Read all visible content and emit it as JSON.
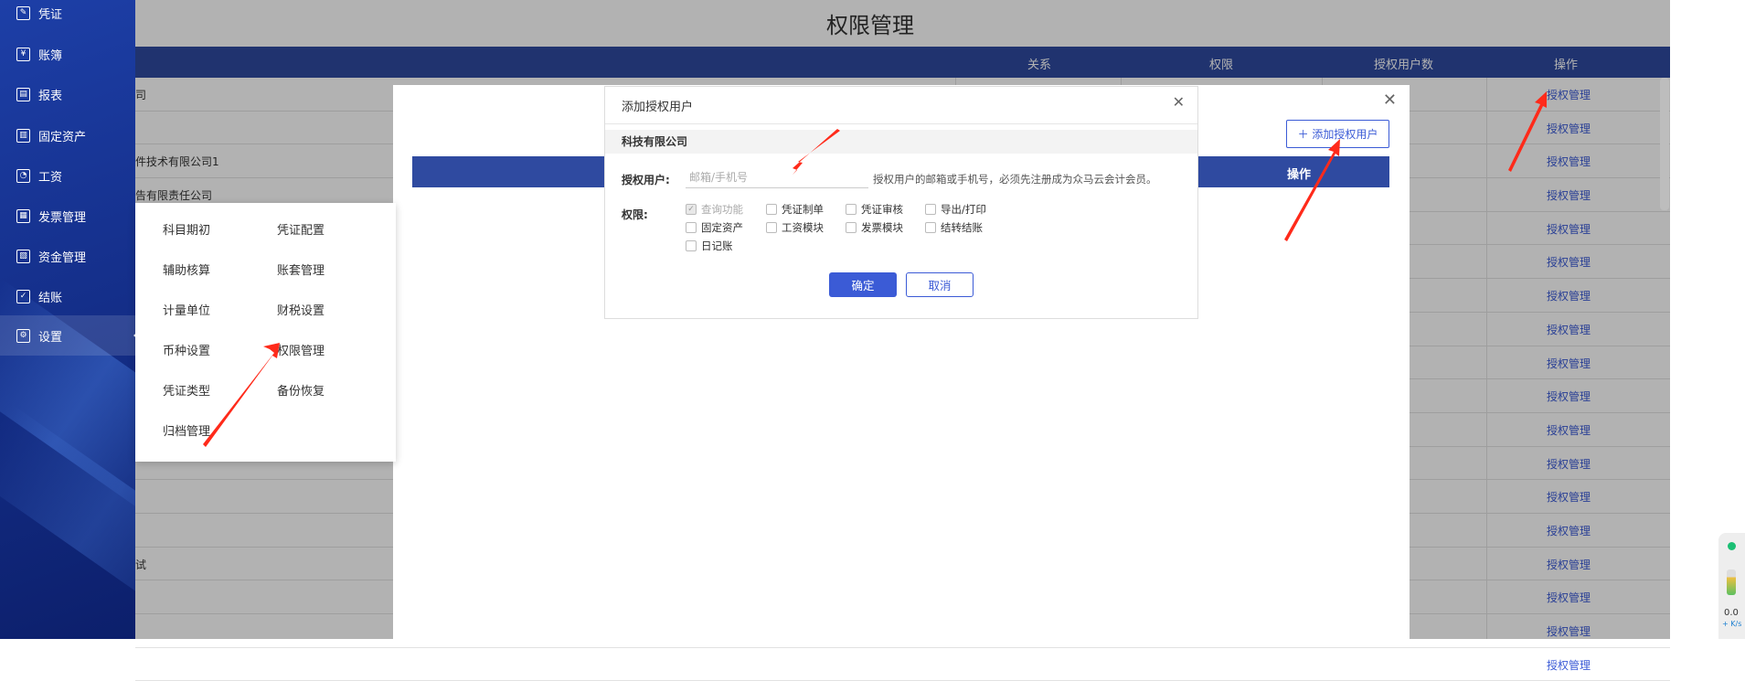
{
  "sidebar": {
    "items": [
      {
        "label": "凭证",
        "icon": "voucher-icon",
        "glyph": "✎"
      },
      {
        "label": "账簿",
        "icon": "yen-icon",
        "glyph": "¥"
      },
      {
        "label": "报表",
        "icon": "report-icon",
        "glyph": "▤"
      },
      {
        "label": "固定资产",
        "icon": "asset-icon",
        "glyph": "▥"
      },
      {
        "label": "工资",
        "icon": "salary-icon",
        "glyph": "◔"
      },
      {
        "label": "发票管理",
        "icon": "invoice-icon",
        "glyph": "▦"
      },
      {
        "label": "资金管理",
        "icon": "funds-icon",
        "glyph": "▧"
      },
      {
        "label": "结账",
        "icon": "checkout-icon",
        "glyph": "✓"
      },
      {
        "label": "设置",
        "icon": "gear-icon",
        "glyph": "⚙"
      }
    ],
    "active_index": 8
  },
  "page": {
    "title": "权限管理",
    "columns": {
      "relation": "关系",
      "permission": "权限",
      "user_count": "授权用户数",
      "actions": "操作"
    }
  },
  "rows": [
    {
      "company": "司",
      "op": "授权管理"
    },
    {
      "company": "",
      "op": "授权管理"
    },
    {
      "company": "件技术有限公司1",
      "op": "授权管理"
    },
    {
      "company": "告有限责任公司",
      "op": "授权管理"
    },
    {
      "company": "",
      "op": "授权管理"
    },
    {
      "company": "",
      "op": "授权管理"
    },
    {
      "company": "",
      "op": "授权管理"
    },
    {
      "company": "",
      "op": "授权管理"
    },
    {
      "company": "",
      "op": "授权管理"
    },
    {
      "company": "",
      "op": "授权管理"
    },
    {
      "company": "",
      "op": "授权管理"
    },
    {
      "company": "",
      "op": "授权管理"
    },
    {
      "company": "",
      "op": "授权管理"
    },
    {
      "company": "",
      "op": "授权管理"
    },
    {
      "company": "试",
      "op": "授权管理"
    },
    {
      "company": "",
      "op": "授权管理"
    },
    {
      "company": "",
      "op": "授权管理"
    },
    {
      "company": "",
      "op": "授权管理"
    }
  ],
  "submenu": {
    "items": [
      "科目期初",
      "凭证配置",
      "辅助核算",
      "账套管理",
      "计量单位",
      "财税设置",
      "币种设置",
      "权限管理",
      "凭证类型",
      "备份恢复",
      "归档管理"
    ]
  },
  "panel": {
    "add_button": "＋ 添加授权用户",
    "actions_header": "操作"
  },
  "dialog": {
    "title": "添加授权用户",
    "company": "科技有限公司",
    "user_label": "授权用户:",
    "user_placeholder": "邮箱/手机号",
    "user_value": "",
    "hint": "授权用户的邮箱或手机号，必须先注册成为众马云会计会员。",
    "perm_label": "权限:",
    "permissions": [
      {
        "label": "查询功能",
        "checked": true,
        "disabled": true
      },
      {
        "label": "凭证制单",
        "checked": false,
        "disabled": false
      },
      {
        "label": "凭证审核",
        "checked": false,
        "disabled": false
      },
      {
        "label": "导出/打印",
        "checked": false,
        "disabled": false
      },
      {
        "label": "固定资产",
        "checked": false,
        "disabled": false
      },
      {
        "label": "工资模块",
        "checked": false,
        "disabled": false
      },
      {
        "label": "发票模块",
        "checked": false,
        "disabled": false
      },
      {
        "label": "结转结账",
        "checked": false,
        "disabled": false
      },
      {
        "label": "日记账",
        "checked": false,
        "disabled": false
      }
    ],
    "ok": "确定",
    "cancel": "取消"
  },
  "widget": {
    "value": "0.0",
    "unit": "+ K/s"
  },
  "colors": {
    "primary": "#3b5bd6",
    "header": "#2f4aa0",
    "sidebar": "#15308c",
    "annotation_arrow": "#ff2a1a"
  }
}
